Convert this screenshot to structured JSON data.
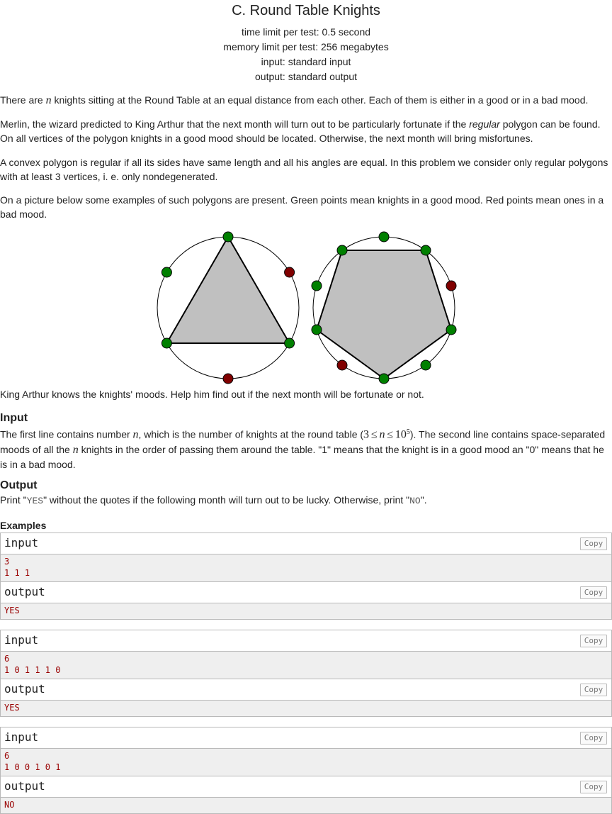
{
  "problem": {
    "title": "C. Round Table Knights",
    "time_limit": "time limit per test: 0.5 second",
    "memory_limit": "memory limit per test: 256 megabytes",
    "input_file": "input: standard input",
    "output_file": "output: standard output"
  },
  "statement": {
    "p1_before": "There are ",
    "p1_var": "n",
    "p1_after": " knights sitting at the Round Table at an equal distance from each other. Each of them is either in a good or in a bad mood.",
    "p2_before": "Merlin, the wizard predicted to King Arthur that the next month will turn out to be particularly fortunate if the ",
    "p2_em": "regular",
    "p2_after": " polygon can be found. On all vertices of the polygon knights in a good mood should be located. Otherwise, the next month will bring misfortunes.",
    "p3": "A convex polygon is regular if all its sides have same length and all his angles are equal. In this problem we consider only regular polygons with at least 3 vertices, i. e. only nondegenerated.",
    "p4": "On a picture below some examples of such polygons are present. Green points mean knights in a good mood. Red points mean ones in a bad mood.",
    "p5": "King Arthur knows the knights' moods. Help him find out if the next month will be fortunate or not."
  },
  "input_section": {
    "title": "Input",
    "t1": "The first line contains number ",
    "var_n": "n",
    "t2": ", which is the number of knights at the round table (",
    "c_3": "3",
    "c_le": "≤",
    "c_ten": "10",
    "c_exp": "5",
    "t3": "). The second line contains space-separated moods of all the ",
    "t4": " knights in the order of passing them around the table. \"1\" means that the knight is in a good mood an \"0\" means that he is in a bad mood."
  },
  "output_section": {
    "title": "Output",
    "t1": "Print \"",
    "yes": "YES",
    "t2": "\" without the quotes if the following month will turn out to be lucky. Otherwise, print \"",
    "no": "NO",
    "t3": "\"."
  },
  "examples": {
    "title": "Examples",
    "input_label": "input",
    "output_label": "output",
    "copy_label": "Copy",
    "items": [
      {
        "input": "3\n1 1 1",
        "output": "YES"
      },
      {
        "input": "6\n1 0 1 1 1 0",
        "output": "YES"
      },
      {
        "input": "6\n1 0 0 1 0 1",
        "output": "NO"
      }
    ]
  },
  "colors": {
    "good": "#008000",
    "bad": "#800000",
    "polygon_fill": "#c0c0c0"
  }
}
